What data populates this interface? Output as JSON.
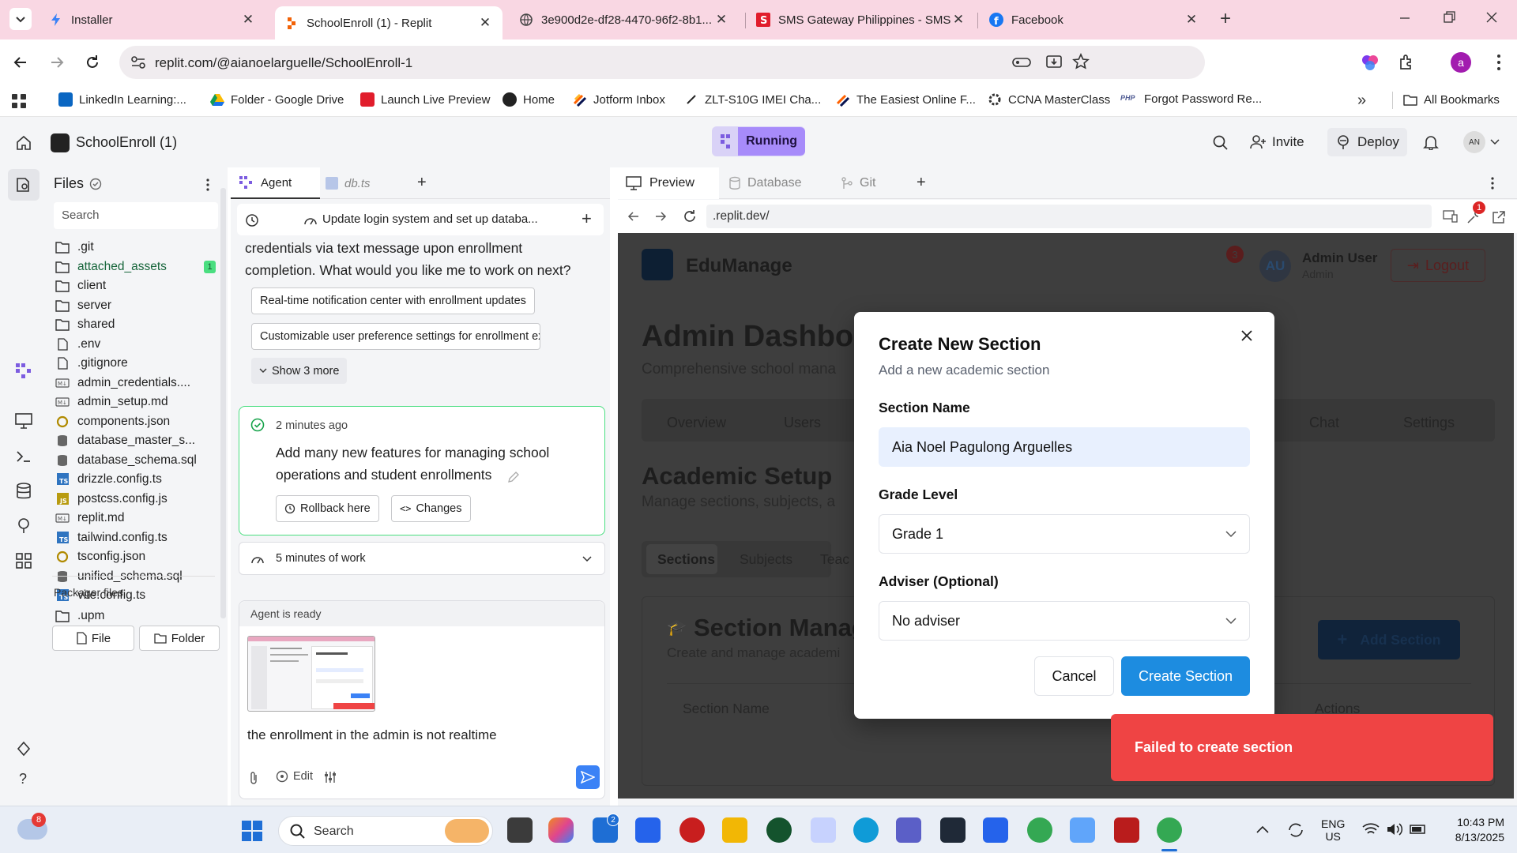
{
  "browser": {
    "tabs": [
      {
        "title": "Installer",
        "active": false
      },
      {
        "title": "SchoolEnroll (1) - Replit",
        "active": true
      },
      {
        "title": "3e900d2e-df28-4470-96f2-8b1...",
        "active": false
      },
      {
        "title": "SMS Gateway Philippines - SMS...",
        "active": false
      },
      {
        "title": "Facebook",
        "active": false
      }
    ],
    "url": "replit.com/@aianoelarguelle/SchoolEnroll-1",
    "profile_initial": "a",
    "bookmarks": [
      "LinkedIn Learning:...",
      "Folder - Google Drive",
      "Launch Live Preview",
      "Home",
      "Jotform Inbox",
      "ZLT-S10G IMEI Cha...",
      "The Easiest Online F...",
      "CCNA MasterClass",
      "Forgot Password Re..."
    ],
    "all_bookmarks": "All Bookmarks"
  },
  "replit": {
    "project_name": "SchoolEnroll (1)",
    "status": "Running",
    "invite_label": "Invite",
    "deploy_label": "Deploy",
    "avatar_initials": "AN",
    "files": {
      "title": "Files",
      "search_placeholder": "Search",
      "items": [
        {
          "name": ".git",
          "type": "folder"
        },
        {
          "name": "attached_assets",
          "type": "folder",
          "badge": "1"
        },
        {
          "name": "client",
          "type": "folder"
        },
        {
          "name": "server",
          "type": "folder"
        },
        {
          "name": "shared",
          "type": "folder"
        },
        {
          "name": ".env",
          "type": "file"
        },
        {
          "name": ".gitignore",
          "type": "file"
        },
        {
          "name": "admin_credentials....",
          "type": "md"
        },
        {
          "name": "admin_setup.md",
          "type": "md"
        },
        {
          "name": "components.json",
          "type": "json"
        },
        {
          "name": "database_master_s...",
          "type": "db"
        },
        {
          "name": "database_schema.sql",
          "type": "db"
        },
        {
          "name": "drizzle.config.ts",
          "type": "ts"
        },
        {
          "name": "postcss.config.js",
          "type": "js"
        },
        {
          "name": "replit.md",
          "type": "md"
        },
        {
          "name": "tailwind.config.ts",
          "type": "ts"
        },
        {
          "name": "tsconfig.json",
          "type": "json"
        },
        {
          "name": "unified_schema.sql",
          "type": "db"
        },
        {
          "name": "vite.config.ts",
          "type": "ts"
        }
      ],
      "packager_title": "Packager files",
      "packager_items": [
        ".upm"
      ],
      "new_file": "File",
      "new_folder": "Folder"
    },
    "agent": {
      "tabs": [
        "Agent",
        "db.ts"
      ],
      "thread_title": "Update login system and set up databa...",
      "message_text": "credentials via text message upon enrollment completion. What would you like me to work on next?",
      "suggestions": [
        "Real-time notification center with enrollment updates",
        "Customizable user preference settings for enrollment expe..."
      ],
      "show_more": "Show 3 more",
      "checkpoint_time": "2 minutes ago",
      "checkpoint_text": "Add many new features for managing school operations and student enrollments",
      "rollback": "Rollback here",
      "changes": "Changes",
      "work_summary": "5 minutes of work",
      "status": "Agent is ready",
      "input_text": "the enrollment in the admin is not realtime",
      "edit_label": "Edit"
    },
    "preview": {
      "tabs": [
        "Preview",
        "Database",
        "Git"
      ],
      "url": ".replit.dev/",
      "notif_count": "1"
    }
  },
  "edumanage": {
    "brand": "EduManage",
    "notif_count": "3",
    "user_initials": "AU",
    "user_name": "Admin User",
    "user_role": "Admin",
    "logout": "Logout",
    "page_title": "Admin Dashbo",
    "page_sub": "Comprehensive school mana",
    "nav": [
      "Overview",
      "Users",
      "Chat",
      "Settings"
    ],
    "section_title": "Academic Setup",
    "section_sub": "Manage sections, subjects, a",
    "subtabs": [
      "Sections",
      "Subjects",
      "Teac"
    ],
    "card_title": "Section Manag",
    "card_sub": "Create and manage academi",
    "add_section": "Add Section",
    "col_section_name": "Section Name",
    "col_actions": "Actions"
  },
  "modal": {
    "title": "Create New Section",
    "subtitle": "Add a new academic section",
    "section_name_label": "Section Name",
    "section_name_value": "Aia Noel Pagulong Arguelles",
    "grade_label": "Grade Level",
    "grade_value": "Grade 1",
    "adviser_label": "Adviser (Optional)",
    "adviser_value": "No adviser",
    "cancel": "Cancel",
    "submit": "Create Section"
  },
  "toast": {
    "message": "Failed to create section"
  },
  "taskbar": {
    "weather_badge": "8",
    "search_placeholder": "Search",
    "store_badge": "2",
    "language": "ENG",
    "region": "US",
    "time": "10:43 PM",
    "date": "8/13/2025"
  }
}
